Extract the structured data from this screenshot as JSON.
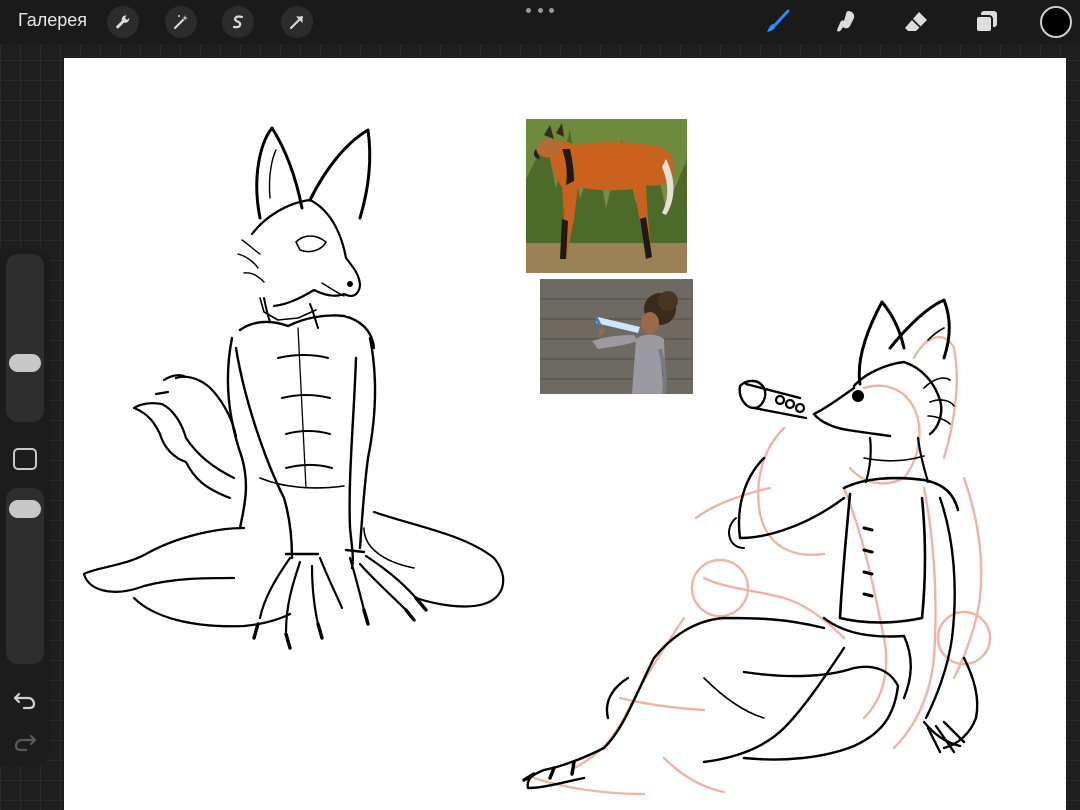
{
  "topbar": {
    "gallery_label": "Галерея",
    "left_tools": [
      "wrench-icon",
      "magic-wand-icon",
      "selection-icon",
      "transform-arrow-icon"
    ],
    "right_tools": [
      "brush-icon",
      "smudge-icon",
      "eraser-icon",
      "layers-icon"
    ],
    "active_tool": "brush-icon",
    "accent_color": "#1f8fff",
    "current_color": "#000000"
  },
  "sidebar": {
    "tools": [
      "brush-size-slider",
      "modify-button",
      "opacity-slider",
      "undo-icon",
      "redo-icon"
    ],
    "brush_size_level": 0.35,
    "opacity_level": 0.2
  },
  "canvas": {
    "background": "#ffffff",
    "sketch_color": "#000000",
    "construction_color": "#f0b3a5",
    "reference_images": [
      "maned-wolf-photo",
      "woman-drinking-photo"
    ]
  }
}
